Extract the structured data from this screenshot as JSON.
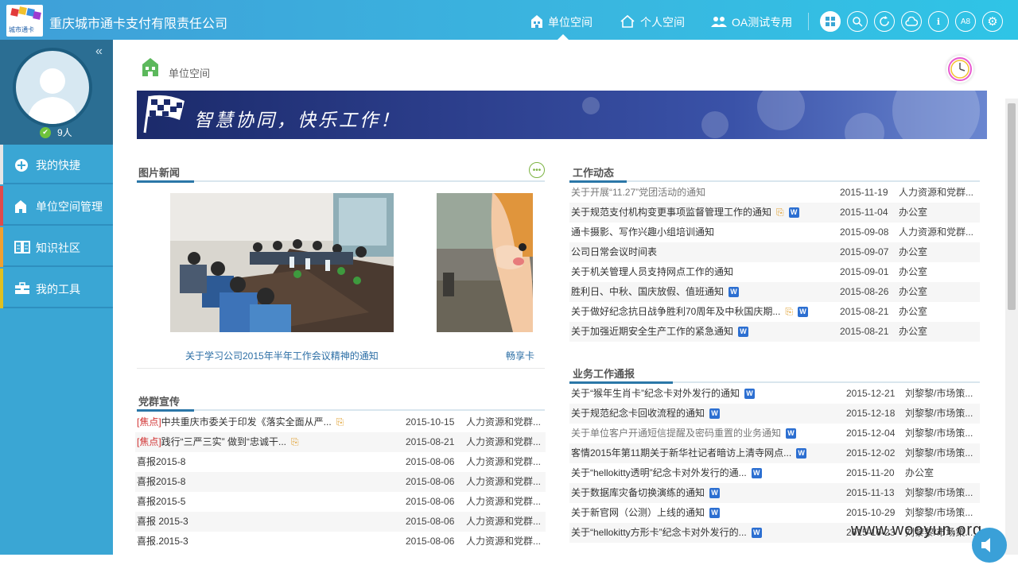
{
  "header": {
    "company": "重庆城市通卡支付有限责任公司",
    "logo_caption": "城市通卡",
    "nav": [
      {
        "label": "单位空间",
        "icon": "building-icon",
        "active": true
      },
      {
        "label": "个人空间",
        "icon": "home-icon",
        "active": false
      },
      {
        "label": "OA测试专用",
        "icon": "group-icon",
        "active": false
      }
    ],
    "tools": [
      {
        "icon": "grid-icon",
        "glyph": "⊞"
      },
      {
        "icon": "search-icon",
        "glyph": "⌕"
      },
      {
        "icon": "refresh-icon",
        "glyph": "↻"
      },
      {
        "icon": "cloud-icon",
        "glyph": "☁"
      },
      {
        "icon": "info-icon",
        "glyph": "i"
      },
      {
        "icon": "font-size-icon",
        "glyph": "A8"
      },
      {
        "icon": "settings-icon",
        "glyph": "⚙"
      }
    ]
  },
  "sidebar": {
    "online_count": "9人",
    "menu": [
      {
        "label": "我的快捷",
        "icon": "plus-circle-icon",
        "color": "#e6e6e6"
      },
      {
        "label": "单位空间管理",
        "icon": "building-icon",
        "color": "#e04a4a"
      },
      {
        "label": "知识社区",
        "icon": "book-icon",
        "color": "#f0a030"
      },
      {
        "label": "我的工具",
        "icon": "toolbox-icon",
        "color": "#e0c020"
      }
    ]
  },
  "breadcrumb": "单位空间",
  "banner": {
    "slogan": "智慧协同，快乐工作！"
  },
  "photo_news": {
    "title": "图片新闻",
    "items": [
      {
        "caption": "关于学习公司2015年半年工作会议精神的通知"
      },
      {
        "caption": "畅享卡"
      }
    ]
  },
  "party": {
    "title": "党群宣传",
    "rows": [
      {
        "tag": "[焦点]",
        "title": "中共重庆市委关于印发《落实全面从严...",
        "clip": true,
        "date": "2015-10-15",
        "org": "人力资源和党群..."
      },
      {
        "tag": "[焦点]",
        "title": "践行“三严三实” 做到“忠诚干...",
        "clip": true,
        "date": "2015-08-21",
        "org": "人力资源和党群..."
      },
      {
        "tag": "",
        "title": "喜报2015-8",
        "clip": false,
        "date": "2015-08-06",
        "org": "人力资源和党群..."
      },
      {
        "tag": "",
        "title": "喜报2015-8",
        "clip": false,
        "date": "2015-08-06",
        "org": "人力资源和党群..."
      },
      {
        "tag": "",
        "title": "喜报2015-5",
        "clip": false,
        "date": "2015-08-06",
        "org": "人力资源和党群..."
      },
      {
        "tag": "",
        "title": "喜报 2015-3",
        "clip": false,
        "date": "2015-08-06",
        "org": "人力资源和党群..."
      },
      {
        "tag": "",
        "title": "喜报.2015-3",
        "clip": false,
        "date": "2015-08-06",
        "org": "人力资源和党群..."
      }
    ]
  },
  "work": {
    "title": "工作动态",
    "rows": [
      {
        "title": "关于开展“11.27”党团活动的通知",
        "read": true,
        "clip": false,
        "doc": false,
        "date": "2015-11-19",
        "org": "人力资源和党群..."
      },
      {
        "title": "关于规范支付机构变更事项监督管理工作的通知",
        "read": false,
        "clip": true,
        "doc": true,
        "date": "2015-11-04",
        "org": "办公室"
      },
      {
        "title": "通卡摄影、写作兴趣小组培训通知",
        "read": false,
        "clip": false,
        "doc": false,
        "date": "2015-09-08",
        "org": "人力资源和党群..."
      },
      {
        "title": "公司日常会议时间表",
        "read": false,
        "clip": false,
        "doc": false,
        "date": "2015-09-07",
        "org": "办公室"
      },
      {
        "title": "关于机关管理人员支持网点工作的通知",
        "read": false,
        "clip": false,
        "doc": false,
        "date": "2015-09-01",
        "org": "办公室"
      },
      {
        "title": "胜利日、中秋、国庆放假、值班通知",
        "read": false,
        "clip": false,
        "doc": true,
        "date": "2015-08-26",
        "org": "办公室"
      },
      {
        "title": "关于做好纪念抗日战争胜利70周年及中秋国庆期...",
        "read": false,
        "clip": true,
        "doc": true,
        "date": "2015-08-21",
        "org": "办公室"
      },
      {
        "title": "关于加强近期安全生产工作的紧急通知",
        "read": false,
        "clip": false,
        "doc": true,
        "date": "2015-08-21",
        "org": "办公室"
      }
    ]
  },
  "business": {
    "title": "业务工作通报",
    "rows": [
      {
        "title": "关于“猴年生肖卡”纪念卡对外发行的通知",
        "read": false,
        "doc": true,
        "date": "2015-12-21",
        "org": "刘黎黎/市场策..."
      },
      {
        "title": "关于规范纪念卡回收流程的通知",
        "read": false,
        "doc": true,
        "date": "2015-12-18",
        "org": "刘黎黎/市场策..."
      },
      {
        "title": "关于单位客户开通短信提醒及密码重置的业务通知",
        "read": true,
        "doc": true,
        "date": "2015-12-04",
        "org": "刘黎黎/市场策..."
      },
      {
        "title": "客情2015年第11期关于新华社记者暗访上清寺网点...",
        "read": false,
        "doc": true,
        "date": "2015-12-02",
        "org": "刘黎黎/市场策..."
      },
      {
        "title": "关于“hellokitty透明”纪念卡对外发行的通...",
        "read": false,
        "doc": true,
        "date": "2015-11-20",
        "org": "办公室"
      },
      {
        "title": "关于数据库灾备切换演练的通知",
        "read": false,
        "doc": true,
        "date": "2015-11-13",
        "org": "刘黎黎/市场策..."
      },
      {
        "title": "关于新官网（公测）上线的通知",
        "read": false,
        "doc": true,
        "date": "2015-10-29",
        "org": "刘黎黎/市场策..."
      },
      {
        "title": "关于“hellokitty方形卡”纪念卡对外发行的...",
        "read": false,
        "doc": true,
        "date": "2015-10-23",
        "org": "刘黎黎/市场策..."
      }
    ]
  },
  "watermark": "www.wooyun.org"
}
